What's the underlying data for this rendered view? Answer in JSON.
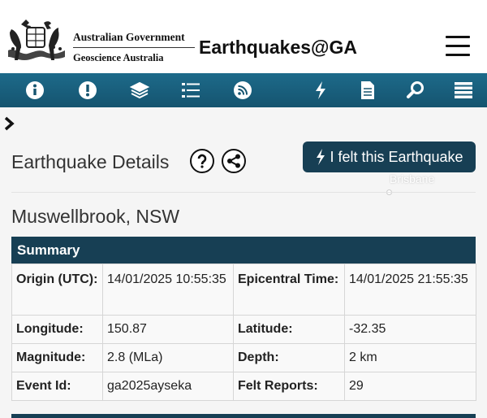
{
  "header": {
    "gov_line1": "Australian Government",
    "gov_line2": "Geoscience Australia",
    "app_title": "Earthquakes@GA"
  },
  "toolbar": {
    "icons": [
      "info-icon",
      "alert-icon",
      "layers-icon",
      "list-icon",
      "rss-icon",
      "lightning-icon",
      "document-icon",
      "search-icon",
      "menu-icon"
    ]
  },
  "details": {
    "title": "Earthquake Details",
    "felt_button": "I felt this Earthquake",
    "map_label": "Brisbane",
    "location": "Muswellbrook, NSW"
  },
  "summary": {
    "heading": "Summary",
    "rows": [
      {
        "l1": "Origin (UTC):",
        "v1": "14/01/2025 10:55:35",
        "l2": "Epicentral Time:",
        "v2": "14/01/2025 21:55:35"
      },
      {
        "l1": "Longitude:",
        "v1": "150.87",
        "l2": "Latitude:",
        "v2": "-32.35"
      },
      {
        "l1": "Magnitude:",
        "v1": "2.8 (MLa)",
        "l2": "Depth:",
        "v2": "2 km"
      },
      {
        "l1": "Event Id:",
        "v1": "ga2025ayseka",
        "l2": "Felt Reports:",
        "v2": "29"
      }
    ]
  },
  "colors": {
    "toolbar": "#15546f",
    "dark_accent": "#173f54"
  }
}
